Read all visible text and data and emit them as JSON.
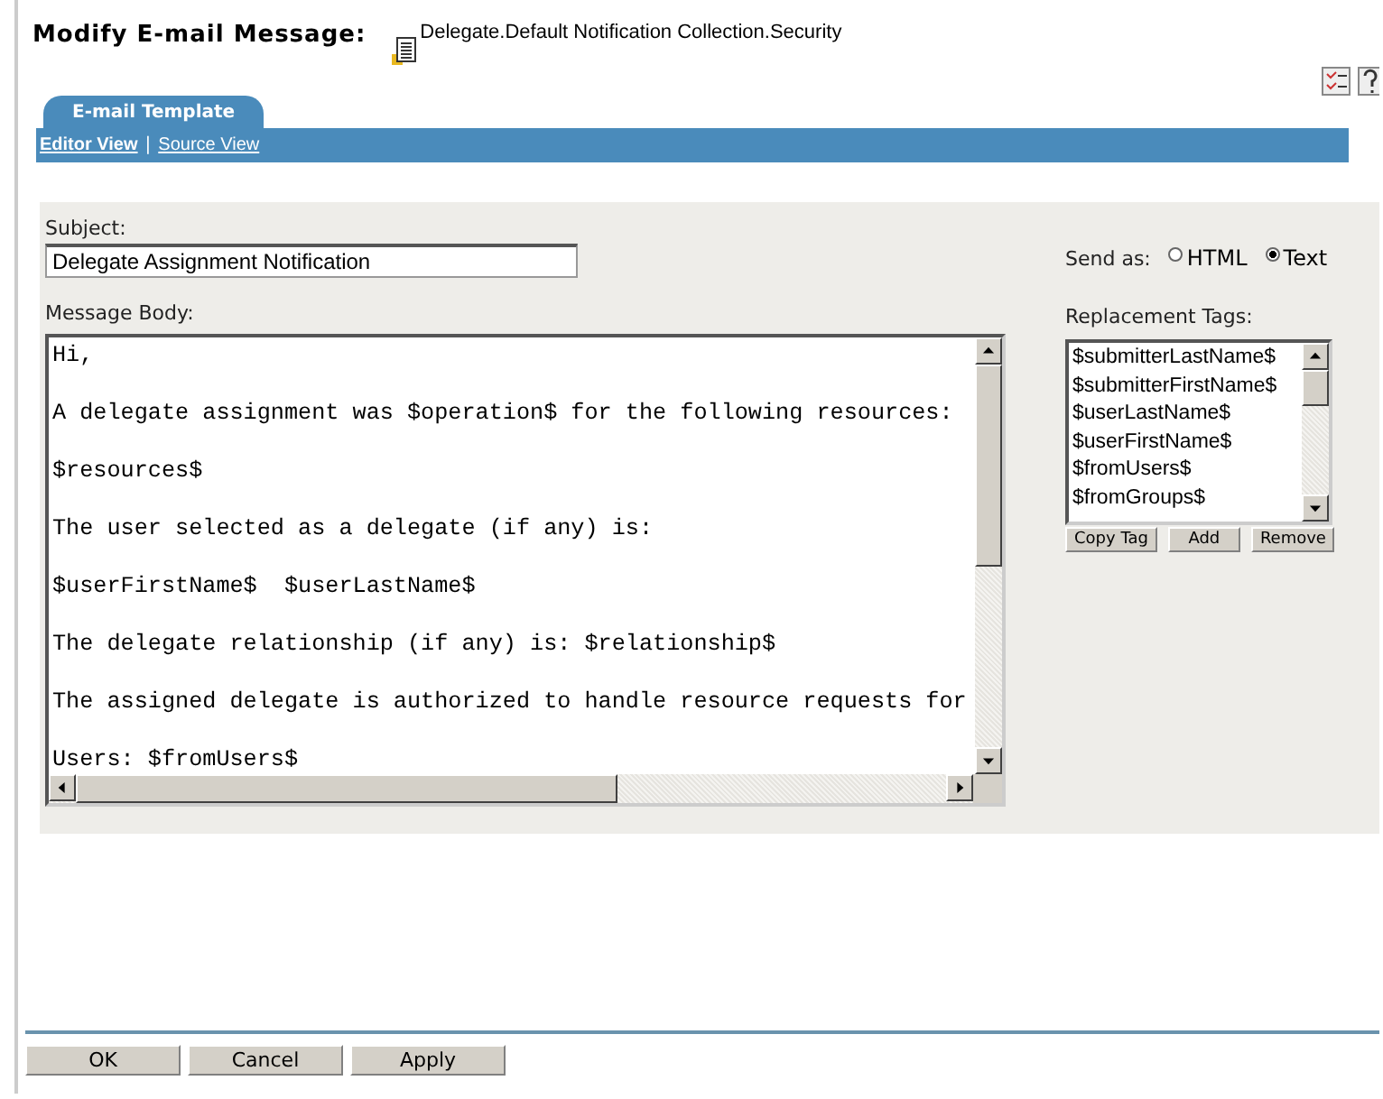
{
  "header": {
    "title": "Modify E-mail Message:",
    "object_name": "Delegate.Default Notification Collection.Security"
  },
  "tabs": [
    {
      "label": "E-mail Template",
      "selected": true
    }
  ],
  "views": [
    {
      "label": "Editor View",
      "selected": true
    },
    {
      "label": "Source View",
      "selected": false
    }
  ],
  "view_separator": "|",
  "subject": {
    "label": "Subject:",
    "value": "Delegate Assignment Notification"
  },
  "send_as": {
    "label": "Send as:",
    "options": [
      {
        "label": "HTML",
        "selected": false
      },
      {
        "label": "Text",
        "selected": true
      }
    ]
  },
  "message_body": {
    "label": "Message Body:",
    "paragraphs": [
      "Hi,",
      "A delegate assignment was $operation$ for the following resources:",
      "$resources$",
      "The user selected as a delegate (if any) is:",
      "$userFirstName$  $userLastName$",
      "The delegate relationship (if any) is: $relationship$",
      "The assigned delegate is authorized to handle resource requests for",
      "Users: $fromUsers$"
    ]
  },
  "replacement_tags": {
    "label": "Replacement Tags:",
    "items": [
      "$submitterLastName$",
      "$submitterFirstName$",
      "$userLastName$",
      "$userFirstName$",
      "$fromUsers$",
      "$fromGroups$"
    ],
    "buttons": [
      "Copy Tag",
      "Add",
      "Remove"
    ]
  },
  "buttons": [
    "OK",
    "Cancel",
    "Apply"
  ]
}
